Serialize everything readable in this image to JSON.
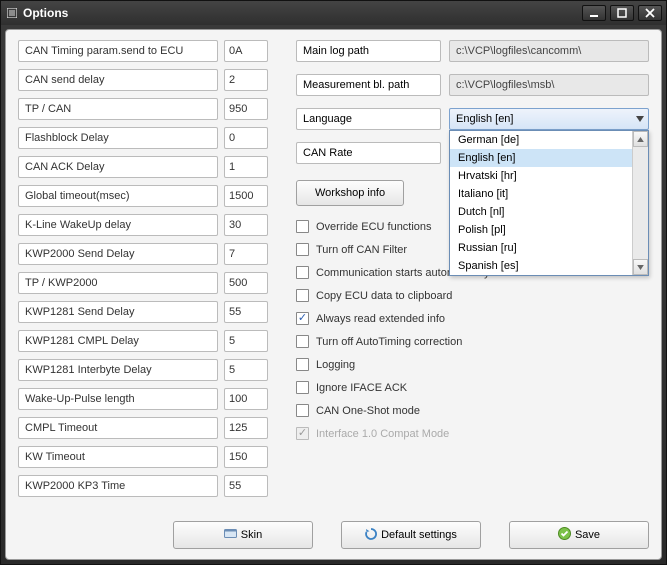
{
  "window": {
    "title": "Options"
  },
  "params": [
    {
      "label": "CAN Timing param.send to ECU",
      "value": "0A"
    },
    {
      "label": "CAN send delay",
      "value": "2"
    },
    {
      "label": "TP / CAN",
      "value": "950"
    },
    {
      "label": "Flashblock Delay",
      "value": "0"
    },
    {
      "label": "CAN ACK Delay",
      "value": "1"
    },
    {
      "label": "Global timeout(msec)",
      "value": "1500"
    },
    {
      "label": "K-Line WakeUp delay",
      "value": "30"
    },
    {
      "label": "KWP2000 Send Delay",
      "value": "7"
    },
    {
      "label": "TP / KWP2000",
      "value": "500"
    },
    {
      "label": "KWP1281 Send Delay",
      "value": "55"
    },
    {
      "label": "KWP1281 CMPL Delay",
      "value": "5"
    },
    {
      "label": "KWP1281 Interbyte Delay",
      "value": "5"
    },
    {
      "label": "Wake-Up-Pulse length",
      "value": "100"
    },
    {
      "label": "CMPL Timeout",
      "value": "125"
    },
    {
      "label": "KW Timeout",
      "value": "150"
    },
    {
      "label": "KWP2000 KP3 Time",
      "value": "55"
    }
  ],
  "paths": {
    "main_log": {
      "label": "Main log path",
      "value": "c:\\VCP\\logfiles\\cancomm\\"
    },
    "measurement": {
      "label": "Measurement bl. path",
      "value": "c:\\VCP\\logfiles\\msb\\"
    }
  },
  "language": {
    "label": "Language",
    "selected": "English [en]",
    "options": [
      "German [de]",
      "English [en]",
      "Hrvatski [hr]",
      "Italiano [it]",
      "Dutch [nl]",
      "Polish [pl]",
      "Russian [ru]",
      "Spanish [es]"
    ]
  },
  "can_rate": {
    "label": "CAN Rate"
  },
  "buttons": {
    "workshop": "Workshop info",
    "skin": "Skin",
    "defaults": "Default settings",
    "save": "Save"
  },
  "checks": [
    {
      "label": "Override ECU functions",
      "checked": false,
      "disabled": false
    },
    {
      "label": "Turn off CAN Filter",
      "checked": false,
      "disabled": false
    },
    {
      "label": "Communication starts automatically",
      "checked": false,
      "disabled": false
    },
    {
      "label": "Copy ECU data to clipboard",
      "checked": false,
      "disabled": false
    },
    {
      "label": "Always read extended info",
      "checked": true,
      "disabled": false
    },
    {
      "label": "Turn off AutoTiming correction",
      "checked": false,
      "disabled": false
    },
    {
      "label": "Logging",
      "checked": false,
      "disabled": false
    },
    {
      "label": "Ignore IFACE ACK",
      "checked": false,
      "disabled": false
    },
    {
      "label": "CAN One-Shot mode",
      "checked": false,
      "disabled": false
    },
    {
      "label": "Interface 1.0 Compat Mode",
      "checked": true,
      "disabled": true
    }
  ]
}
